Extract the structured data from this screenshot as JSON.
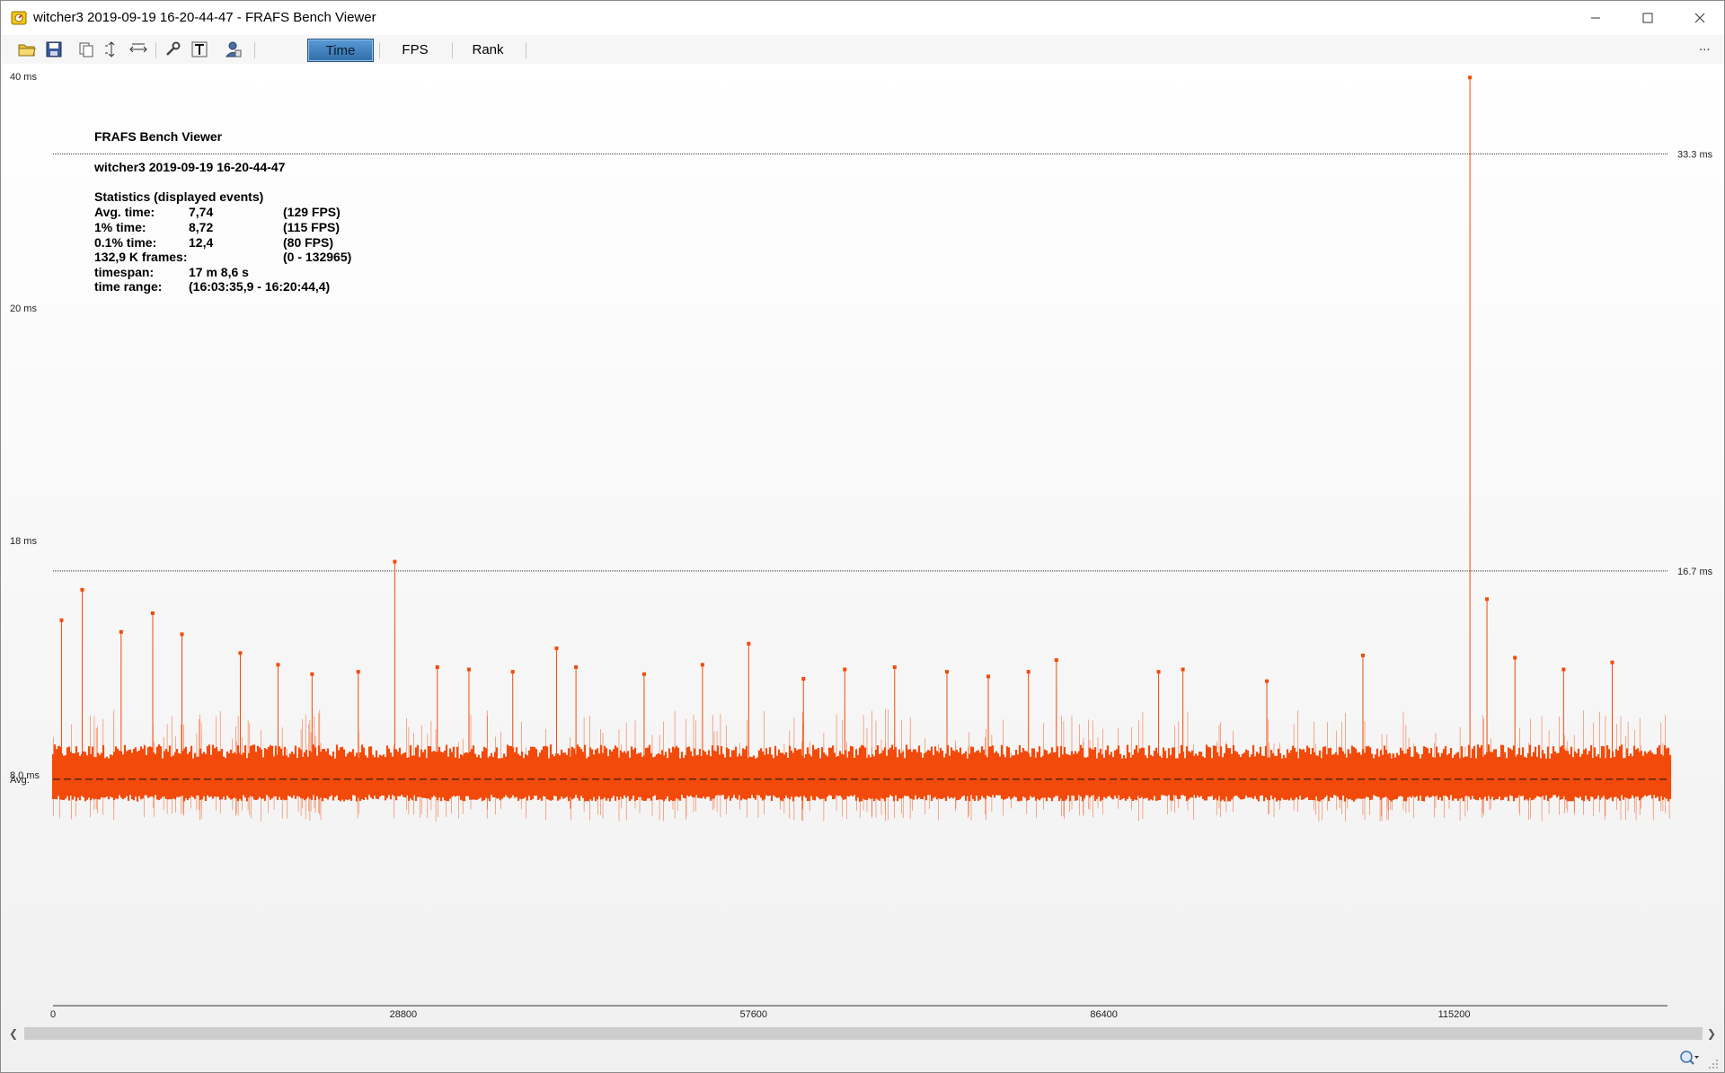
{
  "window": {
    "title": "witcher3 2019-09-19 16-20-44-47 - FRAFS Bench Viewer",
    "controls": [
      "minimize",
      "maximize",
      "close"
    ]
  },
  "toolbar": {
    "icons": [
      "open-folder-icon",
      "save-icon",
      "copy-icon",
      "fit-vertical-icon",
      "fit-horizontal-icon",
      "settings-wrench-icon",
      "text-icon",
      "user-icon"
    ],
    "tabs": [
      {
        "label": "Time",
        "active": true
      },
      {
        "label": "FPS",
        "active": false
      },
      {
        "label": "Rank",
        "active": false
      }
    ],
    "more": "..."
  },
  "info": {
    "app_name": "FRAFS Bench Viewer",
    "session": "witcher3 2019-09-19 16-20-44-47",
    "stats_heading": "Statistics (displayed events)",
    "rows": [
      {
        "label": "Avg. time:",
        "value": "7,74",
        "extra": "(129 FPS)"
      },
      {
        "label": "1% time:",
        "value": "8,72",
        "extra": "(115 FPS)"
      },
      {
        "label": "0.1% time:",
        "value": "12,4",
        "extra": "(80 FPS)"
      },
      {
        "label": "132,9 K frames:",
        "value": "",
        "extra": "(0 - 132965)"
      },
      {
        "label": "timespan:",
        "value": "17 m 8,6 s",
        "extra": ""
      },
      {
        "label": "time range:",
        "value": "(16:03:35,9 - 16:20:44,4)",
        "extra": ""
      }
    ]
  },
  "chart_data": {
    "type": "scatter",
    "x_label": "",
    "y_label": "",
    "x_ticks": [
      0,
      28800,
      57600,
      86400,
      115200
    ],
    "xlim": [
      0,
      132965
    ],
    "y_ticks": [
      {
        "label": "40 ms",
        "value": 40
      },
      {
        "label": "20 ms",
        "value": 20
      },
      {
        "label": "18 ms",
        "value": 18
      },
      {
        "label": "8,0 ms",
        "value": 8.0
      }
    ],
    "avg_label": "Avg.",
    "avg_value": 7.74,
    "reference_lines": [
      {
        "label": "33.3 ms",
        "value": 33.3
      },
      {
        "label": "16.7 ms",
        "value": 16.7
      }
    ],
    "series_color": "#f24a0a",
    "band": {
      "typical_low": 6.8,
      "typical_high": 8.7
    },
    "spikes": [
      {
        "x": 700,
        "y": 14.6
      },
      {
        "x": 2400,
        "y": 15.9
      },
      {
        "x": 5600,
        "y": 14.1
      },
      {
        "x": 8200,
        "y": 14.9
      },
      {
        "x": 10600,
        "y": 14.0
      },
      {
        "x": 15400,
        "y": 13.2
      },
      {
        "x": 18500,
        "y": 12.7
      },
      {
        "x": 21300,
        "y": 12.3
      },
      {
        "x": 25100,
        "y": 12.4
      },
      {
        "x": 28100,
        "y": 17.1
      },
      {
        "x": 31600,
        "y": 12.6
      },
      {
        "x": 34200,
        "y": 12.5
      },
      {
        "x": 37800,
        "y": 12.4
      },
      {
        "x": 41400,
        "y": 13.4
      },
      {
        "x": 43000,
        "y": 12.6
      },
      {
        "x": 48600,
        "y": 12.3
      },
      {
        "x": 53400,
        "y": 12.7
      },
      {
        "x": 57200,
        "y": 13.6
      },
      {
        "x": 61700,
        "y": 12.1
      },
      {
        "x": 65100,
        "y": 12.5
      },
      {
        "x": 69200,
        "y": 12.6
      },
      {
        "x": 73500,
        "y": 12.4
      },
      {
        "x": 76900,
        "y": 12.2
      },
      {
        "x": 80200,
        "y": 12.4
      },
      {
        "x": 82500,
        "y": 12.9
      },
      {
        "x": 90900,
        "y": 12.4
      },
      {
        "x": 92900,
        "y": 12.5
      },
      {
        "x": 99800,
        "y": 12.0
      },
      {
        "x": 107700,
        "y": 13.1
      },
      {
        "x": 116500,
        "y": 39.9
      },
      {
        "x": 117900,
        "y": 15.5
      },
      {
        "x": 120200,
        "y": 13.0
      },
      {
        "x": 124200,
        "y": 12.5
      },
      {
        "x": 128200,
        "y": 12.8
      }
    ]
  },
  "statusbar": {
    "zoom_icon": "zoom-icon",
    "grip_icon": "resize-grip-icon"
  }
}
